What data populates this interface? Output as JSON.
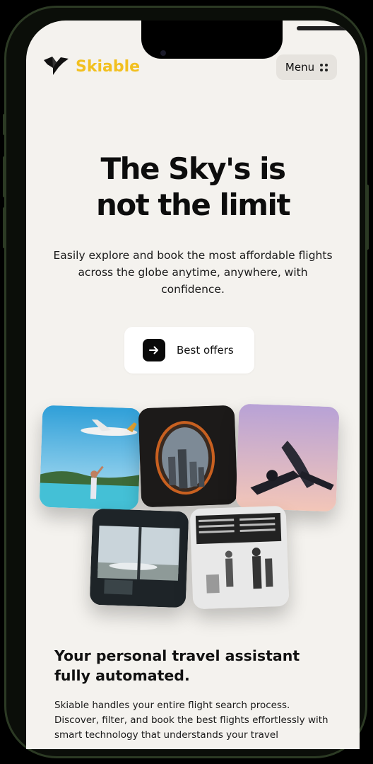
{
  "brand": {
    "name": "Skiable",
    "logo_icon": "bird-logo-icon",
    "accent_color": "#f2c020"
  },
  "header": {
    "menu_label": "Menu",
    "menu_icon": "grid-dots-icon"
  },
  "hero": {
    "title": "The Sky's is\nnot the limit",
    "subtitle": "Easily explore and book the most affordable flights across the globe anytime, anywhere, with confidence.",
    "cta_label": "Best offers",
    "cta_icon": "arrow-right-icon"
  },
  "gallery": {
    "images": [
      "plane-over-beach-photo",
      "airplane-window-city-photo",
      "plane-takeoff-sunset-photo",
      "airport-lounge-window-photo",
      "departure-board-travelers-photo"
    ]
  },
  "features": {
    "title": "Your personal travel assistant\nfully automated.",
    "body": "Skiable handles your entire flight search process. Discover, filter, and book the best flights effortlessly with smart technology that understands your travel"
  }
}
